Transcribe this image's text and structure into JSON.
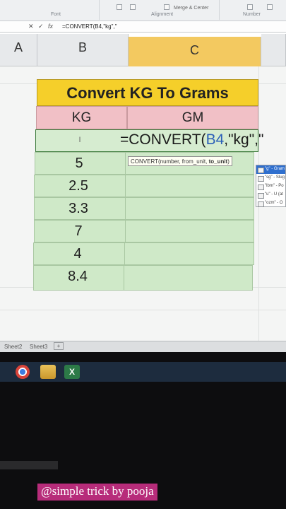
{
  "ribbon": {
    "groups": [
      "Font",
      "Alignment",
      "Number"
    ],
    "merge_label": "Merge & Center"
  },
  "formula_bar": {
    "cancel_icon": "x-icon",
    "enter_icon": "check-icon",
    "fx_label": "fx",
    "content": "=CONVERT(B4,\"kg\",\""
  },
  "columns": [
    "A",
    "B",
    "C"
  ],
  "table": {
    "title": "Convert KG To Grams",
    "headers": [
      "KG",
      "GM"
    ],
    "active_cell_marker": "I",
    "active_formula_prefix": "=CONVERT(",
    "active_formula_ref": "B4",
    "active_formula_suffix": ",\"kg\",\"",
    "kg_values": [
      "5",
      "2.5",
      "3.3",
      "7",
      "4",
      "8.4"
    ]
  },
  "tooltip": {
    "prefix": "CONVERT(number, from_unit, ",
    "current_arg": "to_unit",
    "suffix": ")"
  },
  "autocomplete": [
    "\"g\" - Gram",
    "\"sg\" - Slug",
    "\"lbm\" - Po",
    "\"u\" - U (at",
    "\"ozm\" - O"
  ],
  "sheets": [
    "Sheet2",
    "Sheet3"
  ],
  "taskbar": [
    "chrome-icon",
    "folder-icon",
    "excel-icon"
  ],
  "caption": "@simple trick by pooja",
  "colors": {
    "title_bg": "#f5cf2a",
    "header_bg": "#f1c0c6",
    "cell_bg": "#cfe9c8",
    "caption_bg": "#b72c7a",
    "selected_column": "#f3c960"
  }
}
